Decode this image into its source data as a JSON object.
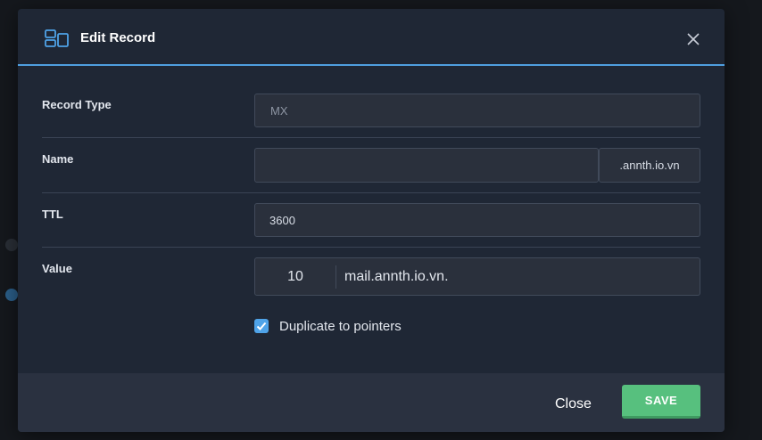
{
  "modal": {
    "title": "Edit Record",
    "icon": "record-layout-icon",
    "accent_color": "#4f9fe0"
  },
  "form": {
    "record_type": {
      "label": "Record Type",
      "value": "MX"
    },
    "name": {
      "label": "Name",
      "value": "",
      "suffix": ".annth.io.vn"
    },
    "ttl": {
      "label": "TTL",
      "value": "3600"
    },
    "value": {
      "label": "Value",
      "priority": "10",
      "target": "mail.annth.io.vn."
    },
    "duplicate": {
      "label": "Duplicate to pointers",
      "checked": true
    }
  },
  "footer": {
    "close_label": "Close",
    "save_label": "SAVE",
    "save_color": "#57c07e"
  }
}
